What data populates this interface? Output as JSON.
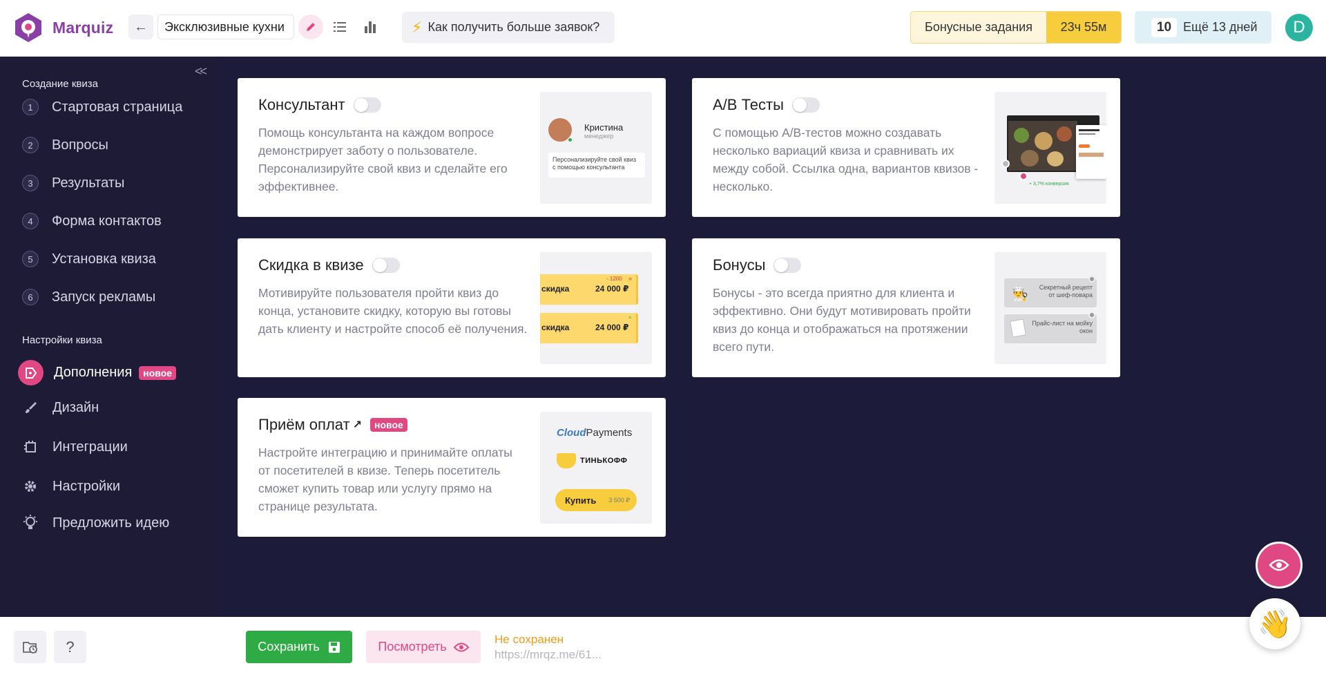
{
  "app": {
    "name": "Marquiz"
  },
  "header": {
    "quiz_name": "Эксклюзивные кухни",
    "howto_label": "Как получить больше заявок?",
    "bonus_label": "Бонусные задания",
    "bonus_timer": "23ч 55м",
    "trial_count": "10",
    "trial_label": "Ещё 13 дней",
    "user_initial": "D"
  },
  "sidebar": {
    "section_create": "Создание квиза",
    "steps": [
      {
        "num": "1",
        "label": "Стартовая страница"
      },
      {
        "num": "2",
        "label": "Вопросы"
      },
      {
        "num": "3",
        "label": "Результаты"
      },
      {
        "num": "4",
        "label": "Форма контактов"
      },
      {
        "num": "5",
        "label": "Установка квиза"
      },
      {
        "num": "6",
        "label": "Запуск рекламы"
      }
    ],
    "section_settings": "Настройки квиза",
    "items": [
      {
        "label": "Дополнения",
        "badge": "новое",
        "icon": "addons-icon",
        "active": true
      },
      {
        "label": "Дизайн",
        "icon": "brush-icon"
      },
      {
        "label": "Интеграции",
        "icon": "integrations-icon"
      },
      {
        "label": "Настройки",
        "icon": "gear-icon"
      },
      {
        "label": "Предложить идею",
        "icon": "lightbulb-icon"
      }
    ]
  },
  "cards": [
    {
      "title": "Консультант",
      "toggle": false,
      "desc": "Помощь консультанта на каждом вопросе демонстрирует заботу о пользователе. Персонализируйте свой квиз и сделайте его эффективнее.",
      "preview": {
        "name": "Кристина",
        "role": "менеджер",
        "text": "Персонализируйте свой квиз с помощью консультанта"
      }
    },
    {
      "title": "A/B Тесты",
      "toggle": false,
      "desc": "С помощью A/B-тестов можно создавать несколько вариаций квиза и сравнивать их между собой. Ссылка одна, вариантов квизов - несколько.",
      "preview": {
        "stat": "+ 3,7% конверсия"
      }
    },
    {
      "title": "Скидка в квизе",
      "toggle": false,
      "desc": "Мотивируйте пользователя пройти квиз до конца, установите скидку, которую вы готовы дать клиенту и настройте способ её получения.",
      "preview": {
        "label": "скидка",
        "amount": "24 000 ₽",
        "delta": "- 1200"
      }
    },
    {
      "title": "Бонусы",
      "toggle": false,
      "desc": "Бонусы - это всегда приятно для клиента и эффективно. Они будут мотивировать пройти квиз до конца и отображаться на протяжении всего пути.",
      "preview": {
        "bonus1": "Секретный рецепт от шеф-повара",
        "bonus2": "Прайс-лист на мойку окон"
      }
    },
    {
      "title": "Приём оплат",
      "badge": "новое",
      "desc": "Настройте интеграцию и принимайте оплаты от посетителей в квизе. Теперь посетитель сможет купить товар или услугу прямо на странице результата.",
      "preview": {
        "cloud_word": "Cloud",
        "payments_word": "Payments",
        "bank": "ТИНЬКОФФ",
        "buy": "Купить",
        "price": "3 500 ₽"
      }
    }
  ],
  "bottom": {
    "save_label": "Сохранить",
    "view_label": "Посмотреть",
    "status": "Не сохранен",
    "link": "https://mrqz.me/61..."
  },
  "colors": {
    "accent": "#e04884",
    "brand": "#8a3fa4",
    "save": "#2eab44",
    "sidebar": "#1d1b35",
    "bonus": "#f7cd3e"
  }
}
